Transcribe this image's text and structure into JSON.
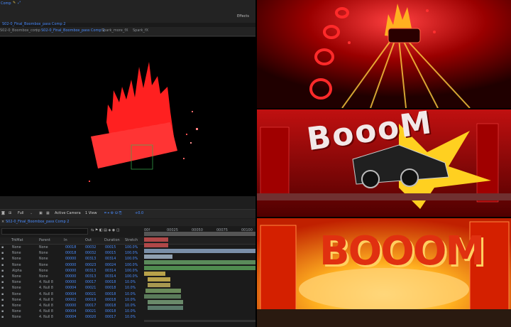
{
  "app": {
    "workspace_label": "Comp",
    "effects_label": "Effects"
  },
  "project_tabs": {
    "project_name": "S02-0_Final_Boombox_pass Comp 2"
  },
  "viewer_tabs": [
    {
      "label": "S02-0_Boombox_comp",
      "active": false
    },
    {
      "label": "S02-0_Final_Boombox_pass Comp 2",
      "active": true
    },
    {
      "label": "Spark_more_fX",
      "active": false
    },
    {
      "label": "Spark_fX",
      "active": false
    }
  ],
  "viewer_bar": {
    "resolution": "Full",
    "camera": "Active Camera",
    "views": "1 View",
    "offset": "+0.0"
  },
  "timeline": {
    "comp_tab": "S02-0_Final_Boombox_pass Comp 2",
    "columns": [
      "TrkMat",
      "Parent",
      "In",
      "Out",
      "Duration",
      "Stretch"
    ],
    "ruler": [
      "00f",
      "00025",
      "00050",
      "00075",
      "00100"
    ],
    "layers": [
      {
        "trkmat": "None",
        "parent": "None",
        "in": "00018",
        "out": "00032",
        "dur": "00015",
        "stretch": "100.0%"
      },
      {
        "trkmat": "None",
        "parent": "None",
        "in": "00018",
        "out": "00032",
        "dur": "00015",
        "stretch": "100.0%"
      },
      {
        "trkmat": "None",
        "parent": "None",
        "in": "00000",
        "out": "00313",
        "dur": "00314",
        "stretch": "100.0%"
      },
      {
        "trkmat": "None",
        "parent": "None",
        "in": "00000",
        "out": "00023",
        "dur": "00024",
        "stretch": "100.0%"
      },
      {
        "trkmat": "Alpha",
        "parent": "None",
        "in": "00000",
        "out": "00313",
        "dur": "00314",
        "stretch": "100.0%"
      },
      {
        "trkmat": "None",
        "parent": "None",
        "in": "00000",
        "out": "00313",
        "dur": "00314",
        "stretch": "100.0%"
      },
      {
        "trkmat": "None",
        "parent": "4. Null 8",
        "in": "00000",
        "out": "00017",
        "dur": "00018",
        "stretch": "10.0%"
      },
      {
        "trkmat": "None",
        "parent": "4. Null 8",
        "in": "00004",
        "out": "00021",
        "dur": "00018",
        "stretch": "10.0%"
      },
      {
        "trkmat": "None",
        "parent": "4. Null 8",
        "in": "00004",
        "out": "00021",
        "dur": "00018",
        "stretch": "10.0%"
      },
      {
        "trkmat": "None",
        "parent": "4. Null 8",
        "in": "00002",
        "out": "00019",
        "dur": "00018",
        "stretch": "10.0%"
      },
      {
        "trkmat": "None",
        "parent": "4. Null 8",
        "in": "00000",
        "out": "00017",
        "dur": "00018",
        "stretch": "10.0%"
      },
      {
        "trkmat": "None",
        "parent": "4. Null 8",
        "in": "00004",
        "out": "00021",
        "dur": "00018",
        "stretch": "10.0%"
      },
      {
        "trkmat": "None",
        "parent": "4. Null 8",
        "in": "00004",
        "out": "00020",
        "dur": "00017",
        "stretch": "10.0%"
      }
    ]
  },
  "storyboard": {
    "panel2_word": "BoooM",
    "panel3_word": "BOOOM"
  },
  "colors": {
    "accent": "#4a8cff",
    "fire": "#ff2a2a",
    "timeline_green": "#4f8a4f",
    "timeline_yellow": "#b8a24a",
    "timeline_blue": "#6a8caa"
  }
}
